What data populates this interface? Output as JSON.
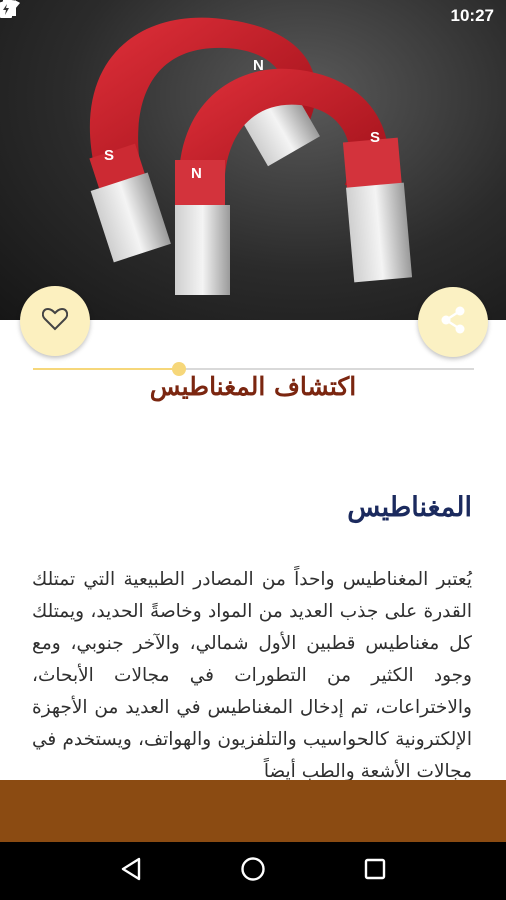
{
  "status_bar": {
    "time": "10:27",
    "icons": [
      "wifi-icon",
      "signal-icon",
      "battery-icon"
    ]
  },
  "hero": {
    "image": "horseshoe-magnets-photo",
    "pole_labels": [
      "S",
      "N",
      "N",
      "S"
    ]
  },
  "actions": {
    "favorite_icon": "heart-outline-icon",
    "share_icon": "share-icon"
  },
  "page_title": "اكتشاف المغناطيس",
  "article": {
    "heading": "المغناطيس",
    "body": "يُعتبر المغناطيس واحداً من المصادر الطبيعية التي تمتلك القدرة على جذب العديد من المواد وخاصةً الحديد، ويمتلك كل مغناطيس قطبين الأول شمالي، والآخر جنوبي، ومع وجود الكثير من التطورات في مجالات الأبحاث، والاختراعات، تم إدخال المغناطيس في العديد من الأجهزة الإلكترونية كالحواسيب والتلفزيون والهواتف، ويستخدم في مجالات الأشعة والطب أيضاً"
  },
  "nav_bar": {
    "back_icon": "back-triangle-icon",
    "home_icon": "home-circle-icon",
    "recents_icon": "recents-square-icon"
  },
  "colors": {
    "title": "#7b2610",
    "heading": "#1b2a5e",
    "fab_background": "#fcf0bf",
    "bottom_banner": "#8b4b12",
    "divider_accent": "#f6d77a"
  }
}
